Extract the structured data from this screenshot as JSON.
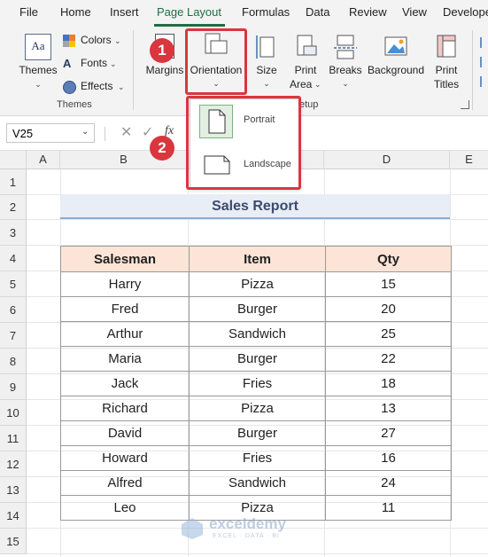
{
  "menu": {
    "tabs": [
      "File",
      "Home",
      "Insert",
      "Page Layout",
      "Formulas",
      "Data",
      "Review",
      "View",
      "Develope"
    ],
    "active": "Page Layout"
  },
  "ribbon": {
    "themes_label": "Themes",
    "colors_label": "Colors",
    "fonts_label": "Fonts",
    "effects_label": "Effects",
    "themes_group": "Themes",
    "margins_label": "Margins",
    "orientation_label": "Orientation",
    "size_label": "Size",
    "print_area_label_1": "Print",
    "print_area_label_2": "Area",
    "breaks_label": "Breaks",
    "background_label": "Background",
    "print_titles_label_1": "Print",
    "print_titles_label_2": "Titles",
    "page_setup_group_partial": "etup",
    "theme_icon_text": "Aa"
  },
  "orientation_menu": {
    "options": [
      "Portrait",
      "Landscape"
    ]
  },
  "badges": [
    "1",
    "2"
  ],
  "formula_bar": {
    "name_box": "V25",
    "fx": "fx"
  },
  "sheet": {
    "columns": [
      "A",
      "B",
      "C",
      "D",
      "E"
    ],
    "rows": [
      "1",
      "2",
      "3",
      "4",
      "5",
      "6",
      "7",
      "8",
      "9",
      "10",
      "11",
      "12",
      "13",
      "14",
      "15"
    ],
    "title": "Sales Report",
    "headers": [
      "Salesman",
      "Item",
      "Qty"
    ],
    "data": [
      [
        "Harry",
        "Pizza",
        "15"
      ],
      [
        "Fred",
        "Burger",
        "20"
      ],
      [
        "Arthur",
        "Sandwich",
        "25"
      ],
      [
        "Maria",
        "Burger",
        "22"
      ],
      [
        "Jack",
        "Fries",
        "18"
      ],
      [
        "Richard",
        "Pizza",
        "13"
      ],
      [
        "David",
        "Burger",
        "27"
      ],
      [
        "Howard",
        "Fries",
        "16"
      ],
      [
        "Alfred",
        "Sandwich",
        "24"
      ],
      [
        "Leo",
        "Pizza",
        "11"
      ]
    ]
  },
  "watermark": {
    "name": "exceldemy",
    "tagline": "EXCEL · DATA · BI"
  },
  "colors": {
    "accent_green": "#1f6e43",
    "highlight_red": "#d9363e",
    "header_fill": "#fce4d6",
    "title_fill": "#e8edf6"
  }
}
